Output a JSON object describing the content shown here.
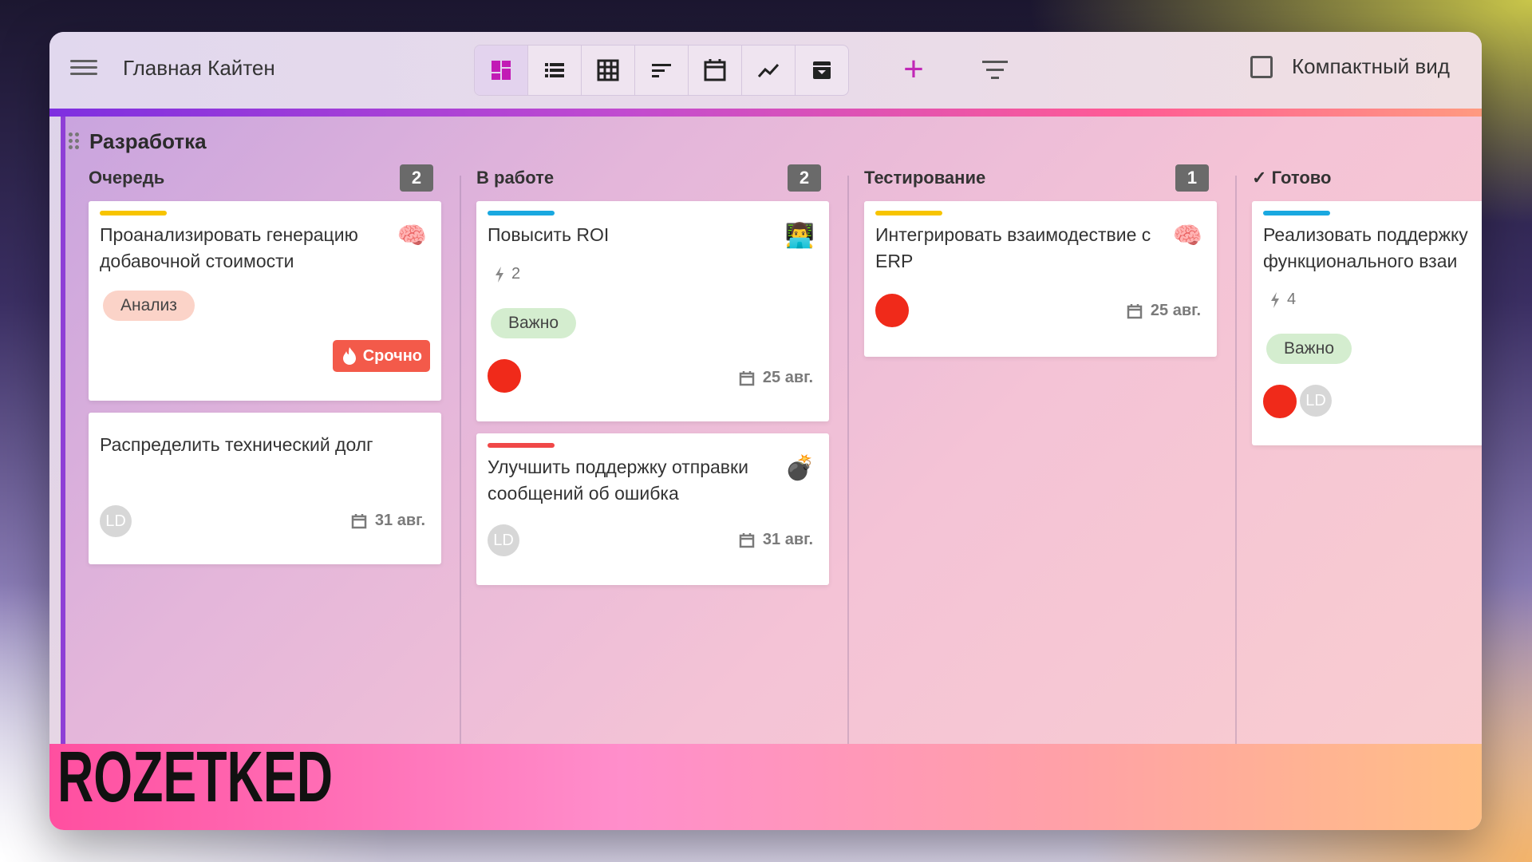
{
  "header": {
    "title": "Главная Кайтен",
    "compact_label": "Компактный вид",
    "view_icons": [
      "board-icon",
      "list-icon",
      "table-icon",
      "sort-icon",
      "calendar-icon",
      "trend-icon",
      "archive-icon"
    ],
    "accent": "#c128b6"
  },
  "board": {
    "title": "Разработка",
    "columns": [
      {
        "title": "Очередь",
        "count": "2"
      },
      {
        "title": "В работе",
        "count": "2"
      },
      {
        "title": "Тестирование",
        "count": "1"
      },
      {
        "title": "Готово",
        "check": "✓"
      }
    ]
  },
  "cards": {
    "c1": {
      "title": "Проанализировать генерацию добавочной стоимости",
      "emoji": "🧠",
      "tag": "Анализ",
      "urgent": "Срочно",
      "stripe": "#f7c400"
    },
    "c2": {
      "title": "Распределить технический долг",
      "avatar": "LD",
      "date": "31 авг."
    },
    "c3": {
      "title": "Повысить ROI",
      "emoji": "👨‍💻",
      "points": "2",
      "tag": "Важно",
      "date": "25 авг.",
      "stripe": "#19a8e0"
    },
    "c4": {
      "title": "Улучшить поддержку отправки сообщений об ошибка",
      "emoji": "💣",
      "avatar": "LD",
      "date": "31 авг.",
      "stripe": "#f04848"
    },
    "c5": {
      "title": "Интегрировать взаимодествие с ERP",
      "emoji": "🧠",
      "date": "25 авг.",
      "stripe": "#f7c400"
    },
    "c6": {
      "title": "Реализовать поддержку функционального взаи",
      "points": "4",
      "tag": "Важно",
      "avatar": "LD",
      "stripe": "#19a8e0"
    }
  },
  "watermark": "ROZETKED"
}
